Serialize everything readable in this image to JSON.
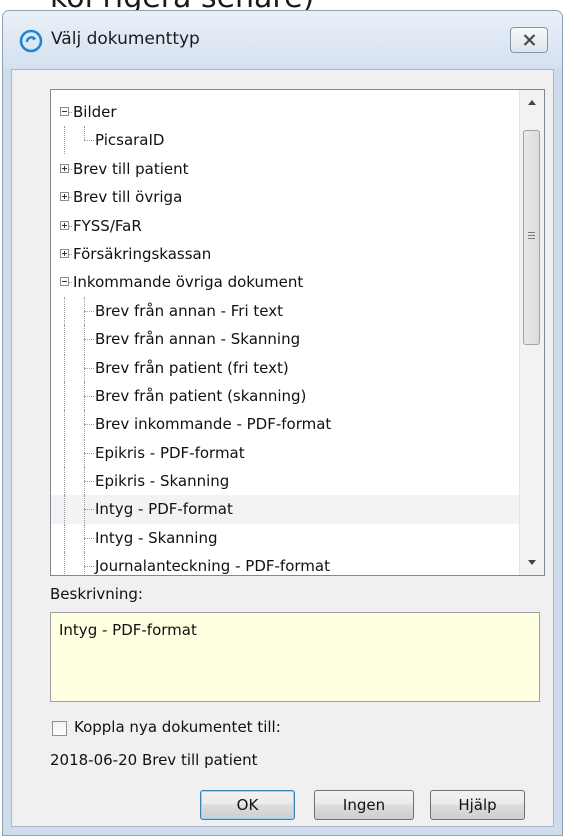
{
  "background_fragment": {
    "text": "kol rigera sehare)"
  },
  "window": {
    "title": "Välj dokumenttyp",
    "app_icon": "refresh-circle-icon",
    "close_icon": "close-icon"
  },
  "tree": {
    "items": [
      {
        "label": "Bilder",
        "level": 0,
        "expander": "minus"
      },
      {
        "label": "PicsaraID",
        "level": 1
      },
      {
        "label": "Brev till patient",
        "level": 0,
        "expander": "plus"
      },
      {
        "label": "Brev till övriga",
        "level": 0,
        "expander": "plus"
      },
      {
        "label": "FYSS/FaR",
        "level": 0,
        "expander": "plus"
      },
      {
        "label": "Försäkringskassan",
        "level": 0,
        "expander": "plus"
      },
      {
        "label": "Inkommande övriga dokument",
        "level": 0,
        "expander": "minus"
      },
      {
        "label": "Brev från annan - Fri text",
        "level": 1
      },
      {
        "label": "Brev från annan - Skanning",
        "level": 1
      },
      {
        "label": "Brev från patient (fri text)",
        "level": 1
      },
      {
        "label": "Brev från patient (skanning)",
        "level": 1
      },
      {
        "label": "Brev inkommande - PDF-format",
        "level": 1
      },
      {
        "label": "Epikris - PDF-format",
        "level": 1
      },
      {
        "label": "Epikris - Skanning",
        "level": 1
      },
      {
        "label": "Intyg - PDF-format",
        "level": 1,
        "selected": true
      },
      {
        "label": "Intyg - Skanning",
        "level": 1
      },
      {
        "label": "Journalanteckning - PDF-format",
        "level": 1
      }
    ]
  },
  "description": {
    "label": "Beskrivning:",
    "value": "Intyg - PDF-format"
  },
  "link_option": {
    "label": "Koppla nya dokumentet till:",
    "checked": false,
    "value": "2018-06-20 Brev till patient"
  },
  "buttons": {
    "ok": "OK",
    "none": "Ingen",
    "help": "Hjälp"
  },
  "colors": {
    "description_bg": "#ffffe1",
    "window_frame": "#cfdcec",
    "app_icon": "#1f84d6",
    "selected_row": "#f3f3f6"
  }
}
